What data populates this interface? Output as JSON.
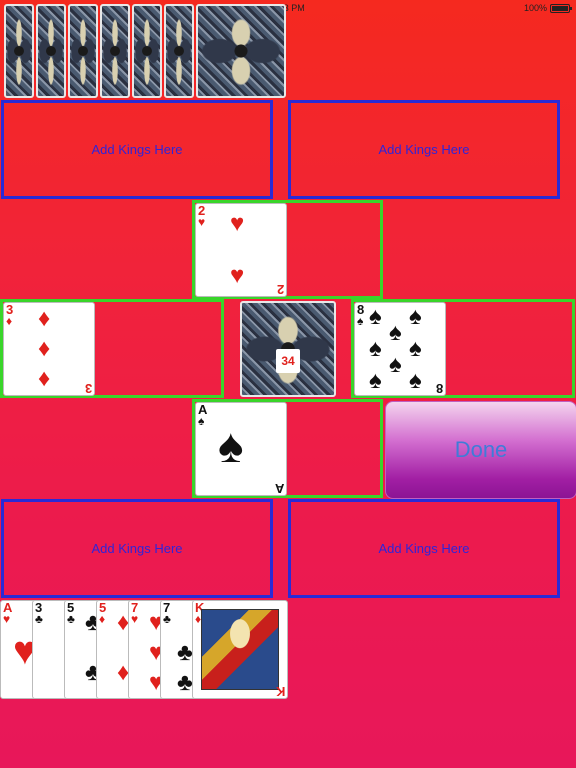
{
  "status_bar": {
    "time": "5:23 PM",
    "battery": "100%"
  },
  "stock_pile": {
    "count_label": "34"
  },
  "kings_areas": {
    "label": "Add Kings Here"
  },
  "done_button": {
    "label": "Done"
  },
  "cards": {
    "top": {
      "rank": "2",
      "suit": "♥"
    },
    "left": {
      "rank": "3",
      "suit": "♦"
    },
    "right": {
      "rank": "8",
      "suit": "♠"
    },
    "bottom": {
      "rank": "A",
      "suit": "♠"
    }
  },
  "hand": [
    {
      "rank": "A",
      "suit": "♥"
    },
    {
      "rank": "3",
      "suit": "♣"
    },
    {
      "rank": "5",
      "suit": "♣"
    },
    {
      "rank": "5",
      "suit": "♦"
    },
    {
      "rank": "7",
      "suit": "♥"
    },
    {
      "rank": "7",
      "suit": "♣"
    },
    {
      "rank": "K",
      "suit": "♦"
    }
  ],
  "colors": {
    "kings_border": "#2a2ad6",
    "slot_border": "#39d52a",
    "done_text": "#3f7cd8"
  }
}
